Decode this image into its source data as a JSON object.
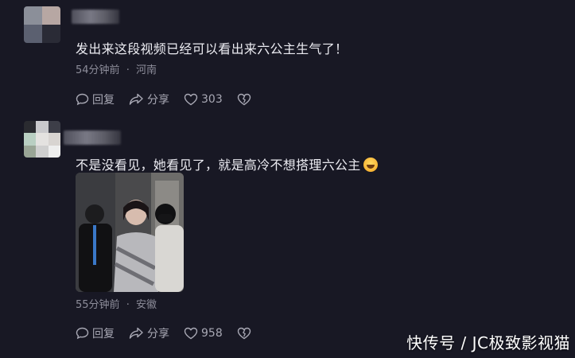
{
  "comments": [
    {
      "text": "发出来这段视频已经可以看出来六公主生气了！",
      "time": "54分钟前",
      "location": "河南",
      "reply_label": "回复",
      "share_label": "分享",
      "likes": "303"
    },
    {
      "text": "不是没看见，她看见了，就是高冷不想搭理六公主",
      "emoji": "rolling-on-floor-laughing-emoji",
      "time": "55分钟前",
      "location": "安徽",
      "reply_label": "回复",
      "share_label": "分享",
      "likes": "958"
    }
  ],
  "separator": "·",
  "watermark": "快传号 / JC极致影视猫",
  "colors": {
    "background": "#181824",
    "text": "#ececf2",
    "meta": "#8d8d9a",
    "action": "#a8a8b4"
  }
}
